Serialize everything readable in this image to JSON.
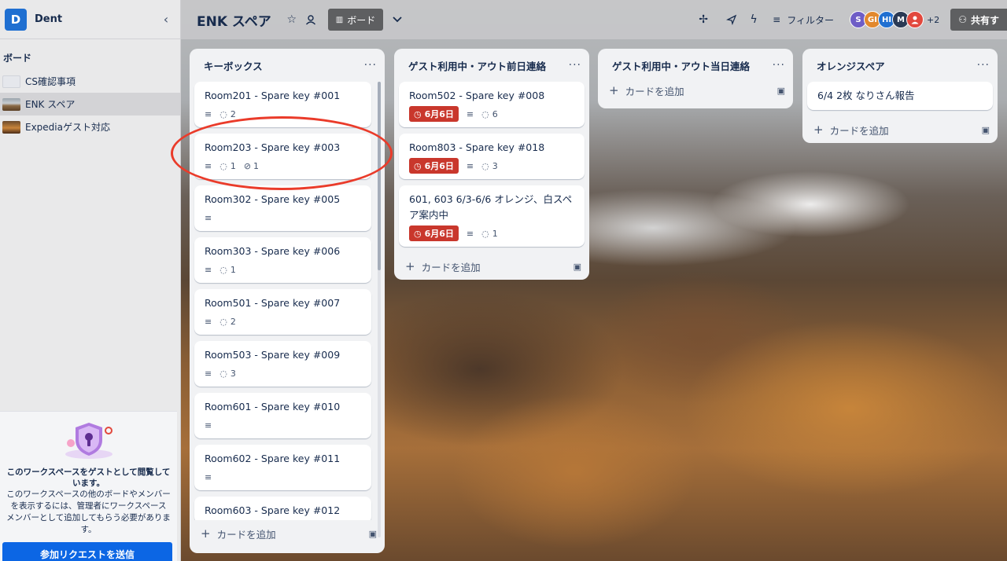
{
  "workspace": {
    "initial": "D",
    "name": "Dent"
  },
  "sidebar": {
    "boards_title": "ボード",
    "boards": [
      {
        "label": "CS確認事項",
        "active": false
      },
      {
        "label": "ENK スペア",
        "active": true
      },
      {
        "label": "Expediaゲスト対応",
        "active": false
      }
    ],
    "guest": {
      "title": "このワークスペースをゲストとして閲覧しています。",
      "body": "このワークスペースの他のボードやメンバーを表示するには、管理者にワークスペース メンバーとして追加してもらう必要があります。",
      "button": "参加リクエストを送信"
    }
  },
  "header": {
    "board_title": "ENK スペア",
    "view_label": "ボード",
    "filter_label": "フィルター",
    "avatars": [
      {
        "initials": "S",
        "color": "#6e5dc6"
      },
      {
        "initials": "GI",
        "color": "#e2882d"
      },
      {
        "initials": "HI",
        "color": "#1f6fd1"
      },
      {
        "initials": "M",
        "color": "#2b3a55"
      },
      {
        "initials": "",
        "color": "#e2483d"
      }
    ],
    "extra_members": "+2",
    "share_label": "共有す"
  },
  "lists": [
    {
      "title": "キーボックス",
      "cards": [
        {
          "title": "Room201 - Spare key #001",
          "comments": "2"
        },
        {
          "title": "Room203 - Spare key #003",
          "comments": "1",
          "attachments": "1"
        },
        {
          "title": "Room302 - Spare key #005"
        },
        {
          "title": "Room303 - Spare key #006",
          "comments": "1"
        },
        {
          "title": "Room501 - Spare key #007",
          "comments": "2"
        },
        {
          "title": "Room503 - Spare key #009",
          "comments": "3"
        },
        {
          "title": "Room601 - Spare key #010"
        },
        {
          "title": "Room602 - Spare key #011"
        },
        {
          "title": "Room603 - Spare key #012"
        }
      ],
      "add_card": "カードを追加"
    },
    {
      "title": "ゲスト利用中・アウト前日連絡",
      "cards": [
        {
          "title": "Room502 - Spare key #008",
          "due": "6月6日",
          "comments": "6"
        },
        {
          "title": "Room803 - Spare key #018",
          "due": "6月6日",
          "comments": "3"
        },
        {
          "title": "601, 603 6/3-6/6 オレンジ、白スペア案内中",
          "due": "6月6日",
          "comments": "1"
        }
      ],
      "add_card": "カードを追加"
    },
    {
      "title": "ゲスト利用中・アウト当日連絡",
      "cards": [],
      "add_card": "カードを追加"
    },
    {
      "title": "オレンジスペア",
      "cards": [
        {
          "title": "6/4 2枚 なりさん報告"
        }
      ],
      "add_card": "カードを追加"
    }
  ]
}
